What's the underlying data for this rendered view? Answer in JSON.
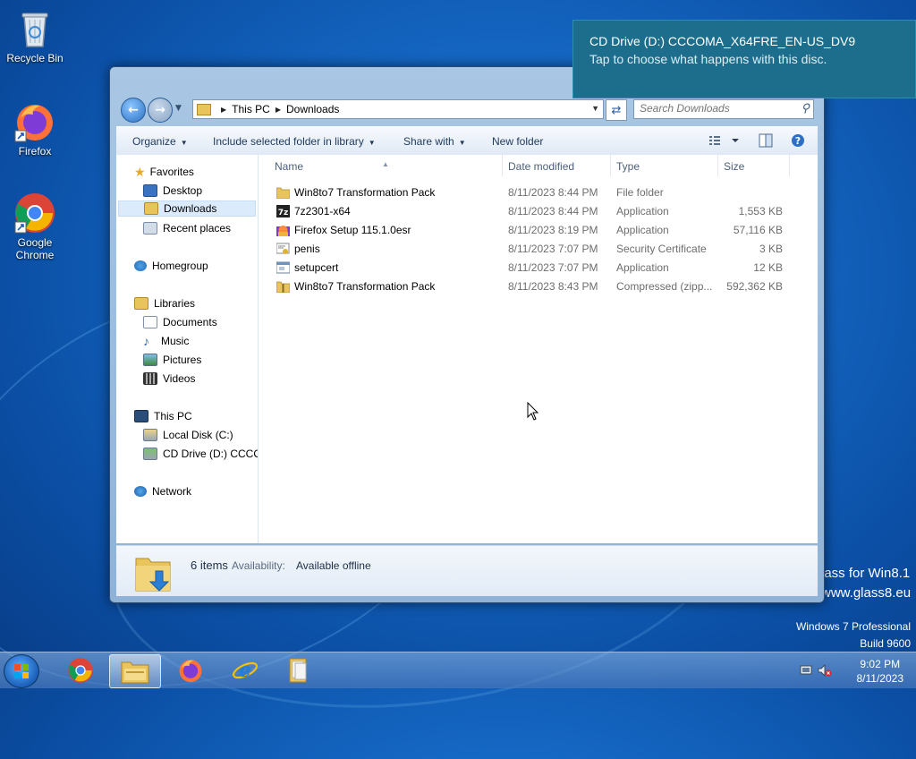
{
  "desktop": {
    "icons": [
      {
        "label": "Recycle Bin"
      },
      {
        "label": "Firefox"
      },
      {
        "label": "Google Chrome"
      }
    ],
    "watermark_brand": "lass for Win8.1",
    "watermark_site": "www.glass8.eu",
    "os_name": "Windows 7 Professional",
    "os_build": "Build 9600"
  },
  "toast": {
    "title": "CD Drive (D:) CCCOMA_X64FRE_EN-US_DV9",
    "message": "Tap to choose what happens with this disc."
  },
  "explorer": {
    "breadcrumb": [
      "This PC",
      "Downloads"
    ],
    "search_placeholder": "Search Downloads",
    "toolbar": {
      "organize": "Organize",
      "include": "Include selected folder in library",
      "share": "Share with",
      "new_folder": "New folder"
    },
    "nav": {
      "favorites": "Favorites",
      "desktop": "Desktop",
      "downloads": "Downloads",
      "recent": "Recent places",
      "homegroup": "Homegroup",
      "libraries": "Libraries",
      "documents": "Documents",
      "music": "Music",
      "pictures": "Pictures",
      "videos": "Videos",
      "thispc": "This PC",
      "localdisk": "Local Disk (C:)",
      "cddrive": "CD Drive (D:) CCCOI",
      "network": "Network"
    },
    "columns": [
      "Name",
      "Date modified",
      "Type",
      "Size"
    ],
    "files": [
      {
        "name": "Win8to7 Transformation Pack",
        "date": "8/11/2023 8:44 PM",
        "type": "File folder",
        "size": "",
        "icon": "folder-icon"
      },
      {
        "name": "7z2301-x64",
        "date": "8/11/2023 8:44 PM",
        "type": "Application",
        "size": "1,553 KB",
        "icon": "7zip-icon"
      },
      {
        "name": "Firefox Setup 115.1.0esr",
        "date": "8/11/2023 8:19 PM",
        "type": "Application",
        "size": "57,116 KB",
        "icon": "firefox-installer-icon"
      },
      {
        "name": "penis",
        "date": "8/11/2023 7:07 PM",
        "type": "Security Certificate",
        "size": "3 KB",
        "icon": "certificate-icon"
      },
      {
        "name": "setupcert",
        "date": "8/11/2023 7:07 PM",
        "type": "Application",
        "size": "12 KB",
        "icon": "application-icon"
      },
      {
        "name": "Win8to7 Transformation Pack",
        "date": "8/11/2023 8:43 PM",
        "type": "Compressed (zipp...",
        "size": "592,362 KB",
        "icon": "zip-folder-icon"
      }
    ],
    "details": {
      "count": "6 items",
      "availability_label": "Availability:",
      "availability_value": "Available offline"
    }
  },
  "taskbar": {
    "time": "9:02 PM",
    "date": "8/11/2023"
  },
  "colors": {
    "toast_bg": "#1d6e8c",
    "selection": "#dcebfc",
    "folder": "#e8c45a"
  }
}
